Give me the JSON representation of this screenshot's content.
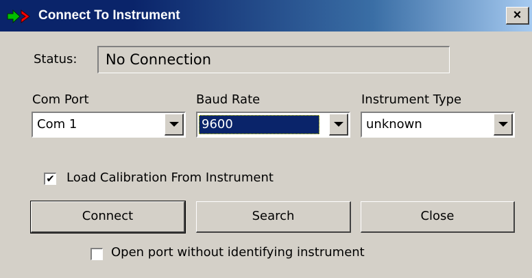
{
  "window": {
    "title": "Connect To Instrument",
    "close_glyph": "×"
  },
  "status": {
    "label": "Status:",
    "value": "No Connection"
  },
  "com_port": {
    "label": "Com Port",
    "value": "Com 1"
  },
  "baud_rate": {
    "label": "Baud Rate",
    "value": "9600"
  },
  "instrument_type": {
    "label": "Instrument Type",
    "value": "unknown"
  },
  "load_calibration": {
    "label": "Load Calibration From Instrument",
    "checked": true,
    "check_glyph": "✔"
  },
  "buttons": {
    "connect": "Connect",
    "search": "Search",
    "close": "Close"
  },
  "open_port": {
    "label": "Open port without identifying instrument",
    "checked": false
  },
  "colors": {
    "title_bar_start": "#0a246a",
    "title_bar_end": "#a6caf0",
    "face": "#d4d0c8",
    "selection": "#0a246a",
    "icon_green": "#00c000",
    "icon_red": "#ff0000"
  },
  "icons": {
    "app": "green-red-arrows-icon",
    "dropdown": "chevron-down-icon",
    "close": "close-icon"
  }
}
